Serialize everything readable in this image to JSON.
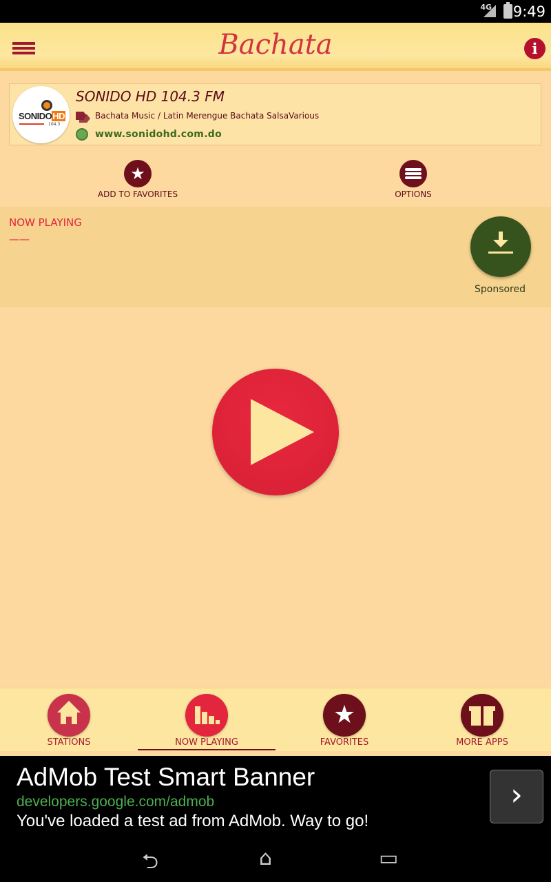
{
  "status_bar": {
    "network": "4G",
    "time": "9:49"
  },
  "app_bar": {
    "title": "Bachata"
  },
  "station": {
    "name": "SONIDO HD 104.3 FM",
    "genres": "Bachata Music /  Latin Merengue Bachata SalsaVarious",
    "website": "www.sonidohd.com.do",
    "logo_text_1": "SONIDO",
    "logo_text_2": "HD",
    "logo_sub": "104.3"
  },
  "actions": {
    "favorites_label": "ADD TO FAVORITES",
    "options_label": "OPTIONS"
  },
  "now_playing": {
    "label": "NOW PLAYING",
    "value": "——",
    "sponsored_label": "Sponsored"
  },
  "bottom_nav": {
    "items": [
      {
        "label": "STATIONS",
        "icon": "home-icon",
        "color": "#c8324a"
      },
      {
        "label": "NOW PLAYING",
        "icon": "equalizer-icon",
        "color": "#e3263d",
        "active": true
      },
      {
        "label": "FAVORITES",
        "icon": "star-icon",
        "color": "#6e0f1c"
      },
      {
        "label": "MORE APPS",
        "icon": "gift-icon",
        "color": "#6e0f1c"
      }
    ]
  },
  "ad": {
    "title": "AdMob Test Smart Banner",
    "url": "developers.google.com/admob",
    "text": "You've loaded a test ad from AdMob. Way to go!",
    "arrow": "›"
  },
  "colors": {
    "primary_red": "#e3263d",
    "dark_maroon": "#6e0f1c",
    "background": "#fdd9a0",
    "sponsored_green": "#37531d"
  }
}
